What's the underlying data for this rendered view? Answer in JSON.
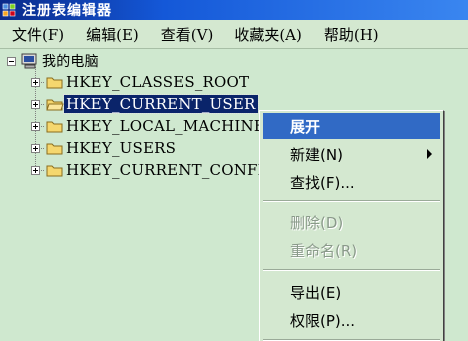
{
  "window": {
    "title": "注册表编辑器",
    "icon": "registry-editor-icon"
  },
  "menubar": {
    "items": [
      "文件(F)",
      "编辑(E)",
      "查看(V)",
      "收藏夹(A)",
      "帮助(H)"
    ]
  },
  "tree": {
    "root": {
      "label": "我的电脑",
      "icon": "computer-icon"
    },
    "keys": [
      {
        "label": "HKEY_CLASSES_ROOT",
        "selected": false
      },
      {
        "label": "HKEY_CURRENT_USER",
        "selected": true
      },
      {
        "label": "HKEY_LOCAL_MACHINE",
        "selected": false
      },
      {
        "label": "HKEY_USERS",
        "selected": false
      },
      {
        "label": "HKEY_CURRENT_CONFIG",
        "selected": false
      }
    ]
  },
  "context_menu": {
    "items": [
      {
        "label": "展开",
        "highlighted": true,
        "disabled": false,
        "submenu": false
      },
      {
        "label": "新建(N)",
        "highlighted": false,
        "disabled": false,
        "submenu": true
      },
      {
        "label": "查找(F)...",
        "highlighted": false,
        "disabled": false,
        "submenu": false
      },
      {
        "label": "删除(D)",
        "highlighted": false,
        "disabled": true,
        "submenu": false
      },
      {
        "label": "重命名(R)",
        "highlighted": false,
        "disabled": true,
        "submenu": false
      },
      {
        "label": "导出(E)",
        "highlighted": false,
        "disabled": false,
        "submenu": false
      },
      {
        "label": "权限(P)...",
        "highlighted": false,
        "disabled": false,
        "submenu": false
      }
    ]
  },
  "colors": {
    "background": "#cfe8cf",
    "titlebar": "#1458d8",
    "selection": "#0a246a",
    "menu_highlight": "#316ac5",
    "folder": "#f5d76e"
  }
}
